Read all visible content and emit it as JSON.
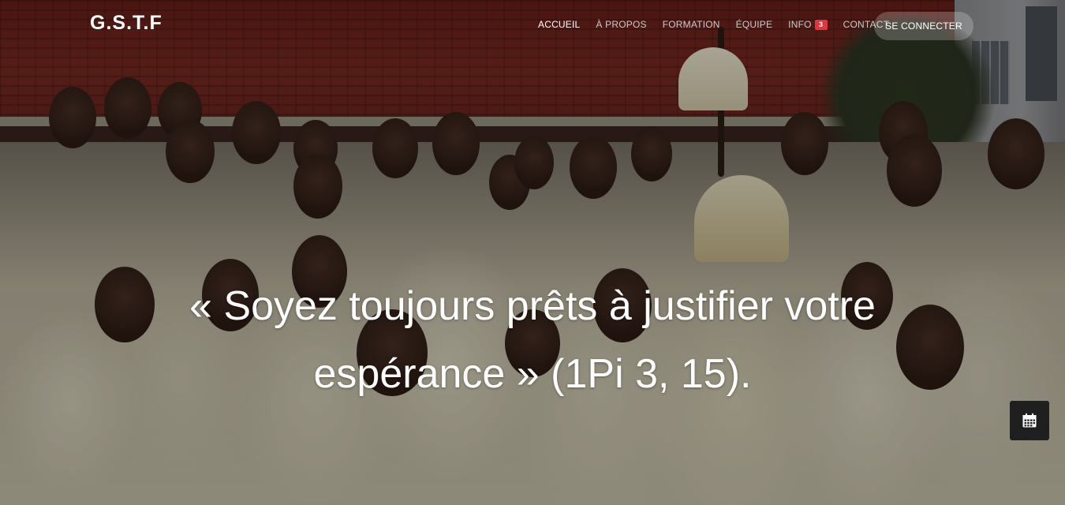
{
  "brand": {
    "name": "G.S.T.F"
  },
  "nav": {
    "items": [
      {
        "label": "ACCUEIL",
        "active": true
      },
      {
        "label": "À PROPOS",
        "active": false
      },
      {
        "label": "FORMATION",
        "active": false
      },
      {
        "label": "ÉQUIPE",
        "active": false
      },
      {
        "label": "INFO",
        "active": false,
        "badge": "3"
      },
      {
        "label": "CONTACT",
        "active": false
      }
    ],
    "login_label": "SE CONNECTER"
  },
  "hero": {
    "quote": "« Soyez toujours prêts à justifier votre espérance » (1Pi 3, 15)."
  },
  "floating": {
    "icon": "calendar-icon"
  },
  "colors": {
    "badge": "#e0343f",
    "text": "#ffffff",
    "nav_inactive": "#c9c9c9",
    "calendar_bg": "#1f1f1f"
  }
}
